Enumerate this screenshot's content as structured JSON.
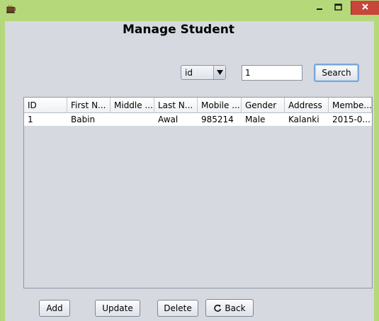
{
  "window": {
    "icon": "coffee-cup-icon",
    "controls": [
      "minimize-icon",
      "maximize-icon",
      "close-icon"
    ]
  },
  "page_title": "Manage Student",
  "search": {
    "field_selected": "id",
    "field_options_visible": [
      "id"
    ],
    "query_value": "1",
    "search_label": "Search"
  },
  "table": {
    "columns": [
      "ID",
      "First N...",
      "Middle ...",
      "Last N...",
      "Mobile ...",
      "Gender",
      "Address",
      "Membe..."
    ],
    "rows": [
      [
        "1",
        "Babin",
        "",
        "Awal",
        "985214",
        "Male",
        "Kalanki",
        "2015-0..."
      ]
    ]
  },
  "actions": {
    "add_label": "Add",
    "update_label": "Update",
    "delete_label": "Delete",
    "back_label": "Back",
    "back_icon": "refresh-icon"
  },
  "colors": {
    "title_bar": "#b5d97a",
    "close_button": "#c7463a",
    "client_background": "#d6d9df",
    "focus_ring": "#7aa6d6"
  }
}
